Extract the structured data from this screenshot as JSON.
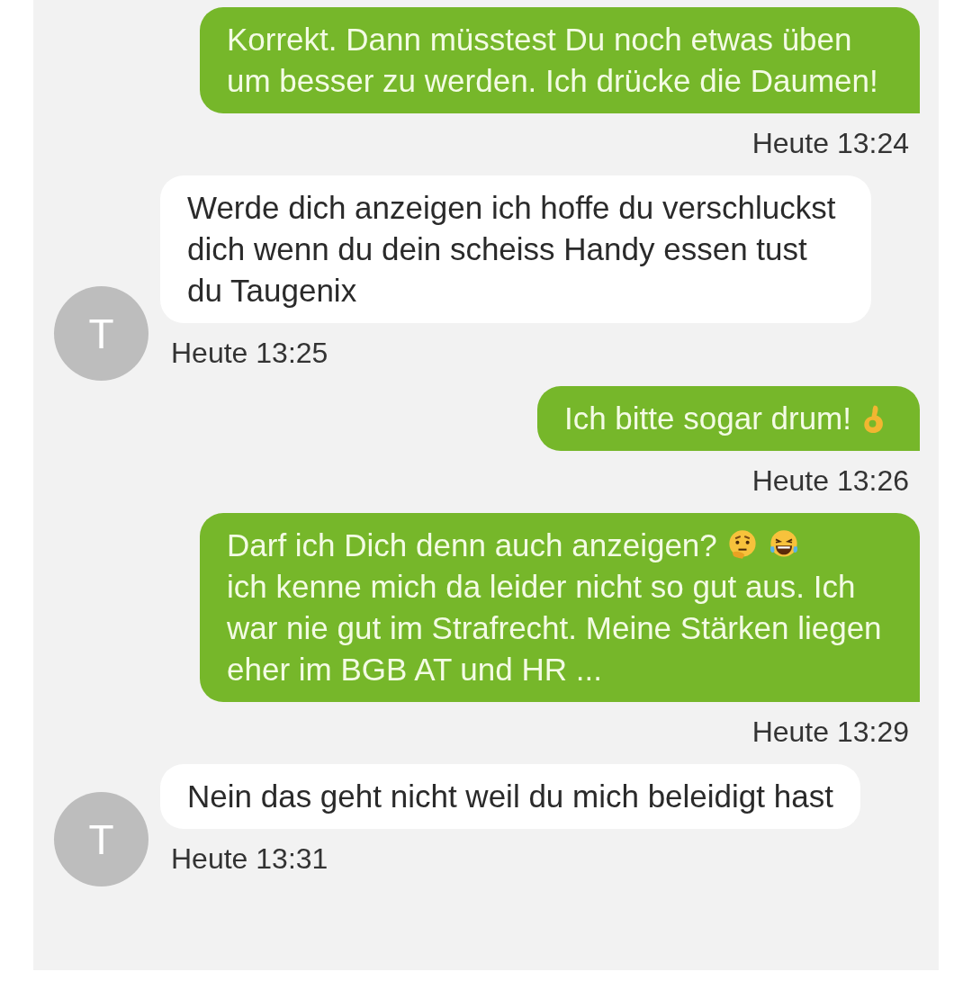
{
  "messages": [
    {
      "kind": "sent",
      "parts": [
        {
          "kind": "text",
          "text": "Korrekt. Dann müsstest Du noch etwas üben um besser zu werden. Ich drücke die Daumen!"
        }
      ],
      "time": "Heute 13:24"
    },
    {
      "kind": "received",
      "avatar": "T",
      "parts": [
        {
          "kind": "text",
          "text": "Werde dich anzeigen ich hoffe du verschluckst dich wenn du dein scheiss Handy essen tust du Taugenix"
        }
      ],
      "time": "Heute 13:25"
    },
    {
      "kind": "sent",
      "parts": [
        {
          "kind": "text",
          "text": "Ich bitte sogar drum!"
        },
        {
          "kind": "emoji"
        }
      ],
      "time": "Heute 13:26"
    },
    {
      "kind": "sent",
      "parts": [
        {
          "kind": "text",
          "text": "Darf ich Dich denn auch anzeigen?"
        },
        {
          "kind": "emoji"
        },
        {
          "kind": "emoji"
        },
        {
          "kind": "text",
          "text": "ich kenne mich da leider nicht so gut aus. Ich war nie gut im Strafrecht. Meine Stärken liegen eher im BGB AT und HR ..."
        }
      ],
      "time": "Heute 13:29"
    },
    {
      "kind": "received",
      "avatar": "T",
      "parts": [
        {
          "kind": "text",
          "text": "Nein das geht nicht weil du mich beleidigt hast"
        }
      ],
      "time": "Heute 13:31"
    }
  ]
}
